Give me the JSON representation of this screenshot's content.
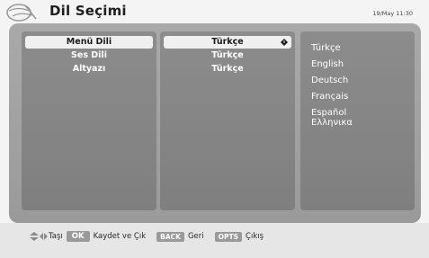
{
  "header": {
    "title": "Dil Seçimi",
    "datetime": "19/May 11:30"
  },
  "settings": [
    {
      "label": "Menü Dili",
      "value": "Türkçe",
      "selected": true
    },
    {
      "label": "Ses Dili",
      "value": "Türkçe",
      "selected": false
    },
    {
      "label": "Altyazı",
      "value": "Türkçe",
      "selected": false
    }
  ],
  "languages": [
    "Türkçe",
    "English",
    "Deutsch",
    "Français",
    "Español",
    "Ελληνικα"
  ],
  "footer": {
    "move_label": "Taşı",
    "ok_key": "OK",
    "ok_label": "Kaydet ve Çık",
    "back_key": "BACK",
    "back_label": "Geri",
    "opts_key": "OPTS",
    "opts_label": "Çıkış"
  },
  "colors": {
    "frame": "#9f9f9f",
    "panel": "#868686",
    "selected_row": "#f0f0f0"
  }
}
